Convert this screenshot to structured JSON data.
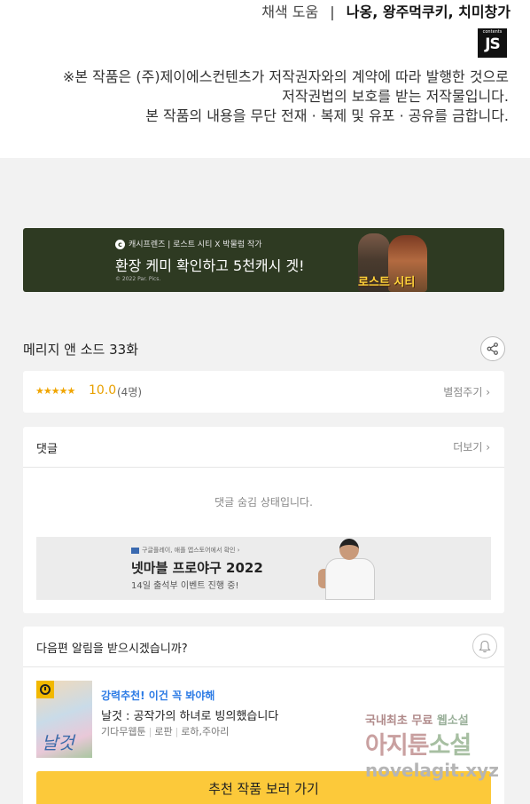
{
  "credits": {
    "role_label": "채색 도움",
    "separator": "|",
    "names": "나옹, 왕주먹쿠키, 치미창가",
    "logo_small": "contents",
    "logo_text": "JS",
    "notice_lines": [
      "※본 작품은 (주)제이에스컨텐츠가 저작권자와의 계약에 따라 발행한 것으로",
      "저작권법의 보호를 받는 저작물입니다.",
      "본 작품의 내용을 무단 전재 · 복제 및 유포 · 공유를 금합니다."
    ]
  },
  "banner": {
    "brand_icon": "c",
    "sub": "캐시프렌즈 | 로스트 시티 X 박물럼 작가",
    "main": "환장 케미 확인하고 5천캐시 겟!",
    "copyright": "© 2022 Par. Pics.",
    "movie_title": "로스트 시티"
  },
  "episode": {
    "title": "메리지 앤 소드 33화",
    "share_icon": "share-icon"
  },
  "rating": {
    "stars": "★★★★★",
    "score": "10.0",
    "count": "(4명)",
    "rate_link": "별점주기 ›"
  },
  "comments": {
    "heading": "댓글",
    "more_link": "더보기 ›",
    "hidden_message": "댓글 숨김 상태입니다."
  },
  "ad": {
    "sub": "구글플레이, 애플 앱스토어에서 확인 ›",
    "title": "넷마블 프로야구 2022",
    "desc": "14일 출석부 이벤트 진행 중!"
  },
  "notify": {
    "question": "다음편 알림을 받으시겠습니까?",
    "bell_icon": "bell-icon",
    "thumb_title": "날것",
    "rec_label": "강력추천! 이건 꼭 봐야해",
    "rec_title": "날것 : 공작가의 하녀로 빙의했습니다",
    "rec_meta": [
      "기다무웹툰",
      "로판",
      "로하,주아리"
    ],
    "cta": "추천 작품 보러 가기"
  },
  "watermark": {
    "line1_a": "국내최초 무료 ",
    "line1_b": "웹소설",
    "line2_a": "아지툰",
    "line2_b": "소설",
    "line3": "novelagit.xyz"
  },
  "colors": {
    "rating_accent": "#e8a000",
    "rec_label": "#2c7be5",
    "cta_bg": "#fcc93a",
    "banner_bg": "#2e3a22"
  }
}
